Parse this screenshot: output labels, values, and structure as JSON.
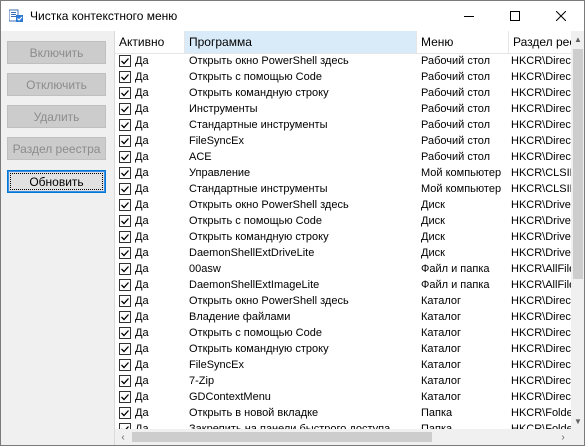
{
  "window": {
    "title": "Чистка контекстного меню"
  },
  "titlebar": {
    "minimize": "—",
    "maximize": "☐",
    "close": "✕"
  },
  "sidebar": {
    "enable_label": "Включить",
    "disable_label": "Отключить",
    "delete_label": "Удалить",
    "registry_label": "Раздел реестра",
    "refresh_label": "Обновить"
  },
  "table": {
    "columns": [
      "Активно",
      "Программа",
      "Меню",
      "Раздел реестра"
    ],
    "rows": [
      {
        "active": "Да",
        "program": "Открыть окно PowerShell здесь",
        "menu": "Рабочий стол",
        "section": "HKCR\\Directo"
      },
      {
        "active": "Да",
        "program": "Открыть с помощью Code",
        "menu": "Рабочий стол",
        "section": "HKCR\\Directo"
      },
      {
        "active": "Да",
        "program": "Открыть командную строку",
        "menu": "Рабочий стол",
        "section": "HKCR\\Directo"
      },
      {
        "active": "Да",
        "program": "Инструменты",
        "menu": "Рабочий стол",
        "section": "HKCR\\Directo"
      },
      {
        "active": "Да",
        "program": "Стандартные инструменты",
        "menu": "Рабочий стол",
        "section": "HKCR\\Directo"
      },
      {
        "active": "Да",
        "program": " FileSyncEx",
        "menu": "Рабочий стол",
        "section": "HKCR\\Directo"
      },
      {
        "active": "Да",
        "program": "ACE",
        "menu": "Рабочий стол",
        "section": "HKCR\\Directo"
      },
      {
        "active": "Да",
        "program": "Управление",
        "menu": "Мой компьютер",
        "section": "HKCR\\CLSID"
      },
      {
        "active": "Да",
        "program": "Стандартные инструменты",
        "menu": "Мой компьютер",
        "section": "HKCR\\CLSID"
      },
      {
        "active": "Да",
        "program": "Открыть окно PowerShell здесь",
        "menu": "Диск",
        "section": "HKCR\\Drive\\"
      },
      {
        "active": "Да",
        "program": "Открыть с помощью Code",
        "menu": "Диск",
        "section": "HKCR\\Drive\\"
      },
      {
        "active": "Да",
        "program": "Открыть командную строку",
        "menu": "Диск",
        "section": "HKCR\\Drive\\"
      },
      {
        "active": "Да",
        "program": "DaemonShellExtDriveLite",
        "menu": "Диск",
        "section": "HKCR\\Drive\\"
      },
      {
        "active": "Да",
        "program": "00asw",
        "menu": "Файл и папка",
        "section": "HKCR\\AllFiles"
      },
      {
        "active": "Да",
        "program": "DaemonShellExtImageLite",
        "menu": "Файл и папка",
        "section": "HKCR\\AllFiles"
      },
      {
        "active": "Да",
        "program": "Открыть окно PowerShell здесь",
        "menu": "Каталог",
        "section": "HKCR\\Directo"
      },
      {
        "active": "Да",
        "program": "Владение файлами",
        "menu": "Каталог",
        "section": "HKCR\\Directo"
      },
      {
        "active": "Да",
        "program": "Открыть с помощью Code",
        "menu": "Каталог",
        "section": "HKCR\\Directo"
      },
      {
        "active": "Да",
        "program": "Открыть командную строку",
        "menu": "Каталог",
        "section": "HKCR\\Directo"
      },
      {
        "active": "Да",
        "program": " FileSyncEx",
        "menu": "Каталог",
        "section": "HKCR\\Directo"
      },
      {
        "active": "Да",
        "program": "7-Zip",
        "menu": "Каталог",
        "section": "HKCR\\Directo"
      },
      {
        "active": "Да",
        "program": "GDContextMenu",
        "menu": "Каталог",
        "section": "HKCR\\Directo"
      },
      {
        "active": "Да",
        "program": "Открыть в новой вкладке",
        "menu": "Папка",
        "section": "HKCR\\Folder"
      },
      {
        "active": "Да",
        "program": "Закрепить на панели быстрого доступа",
        "menu": "Папка",
        "section": "HKCR\\Folder"
      }
    ]
  },
  "icons": {
    "app": "context-menu-app-icon",
    "check": "check-icon"
  }
}
